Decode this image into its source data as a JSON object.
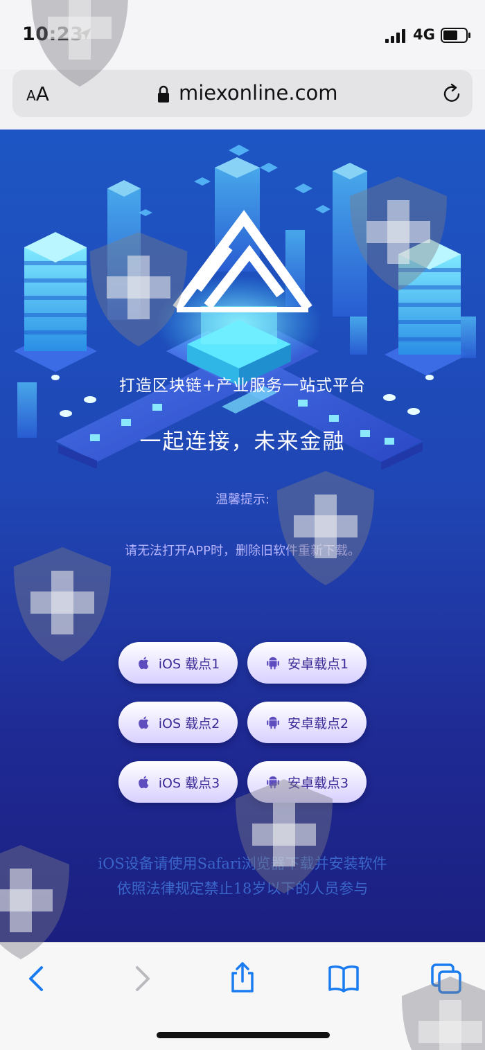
{
  "status_bar": {
    "time": "10:23",
    "network": "4G",
    "icons": [
      "location-arrow-icon",
      "cell-signal-icon",
      "battery-icon"
    ]
  },
  "browser": {
    "text_size_button": {
      "small": "A",
      "large": "A"
    },
    "url": "miexonline.com",
    "icons": [
      "lock-icon",
      "reload-icon"
    ]
  },
  "hero": {
    "subtitle": "打造区块链+产业服务一站式平台",
    "title": "一起连接，未来金融"
  },
  "notice": {
    "title": "温馨提示:",
    "text": "请无法打开APP时，删除旧软件重新下载。"
  },
  "downloads": {
    "ios": [
      {
        "label": "iOS 载点1",
        "icon": "apple-icon"
      },
      {
        "label": "iOS 载点2",
        "icon": "apple-icon"
      },
      {
        "label": "iOS 载点3",
        "icon": "apple-icon"
      }
    ],
    "android": [
      {
        "label": "安卓载点1",
        "icon": "android-icon"
      },
      {
        "label": "安卓载点2",
        "icon": "android-icon"
      },
      {
        "label": "安卓载点3",
        "icon": "android-icon"
      }
    ]
  },
  "footer": {
    "line1": "iOS设备请使用Safari浏览器下载并安装软件",
    "line2": "依照法律规定禁止18岁以下的人员参与"
  },
  "toolbar": {
    "items": [
      "back-icon",
      "forward-icon",
      "share-icon",
      "bookmarks-icon",
      "tabs-icon"
    ]
  },
  "colors": {
    "accent": "#1a7cf0",
    "page_top": "#1d56c4",
    "page_bottom": "#1b1f80",
    "button_text": "#3b2a96",
    "notice_text": "#b7b4ff",
    "footer_text": "#3b66c9"
  }
}
